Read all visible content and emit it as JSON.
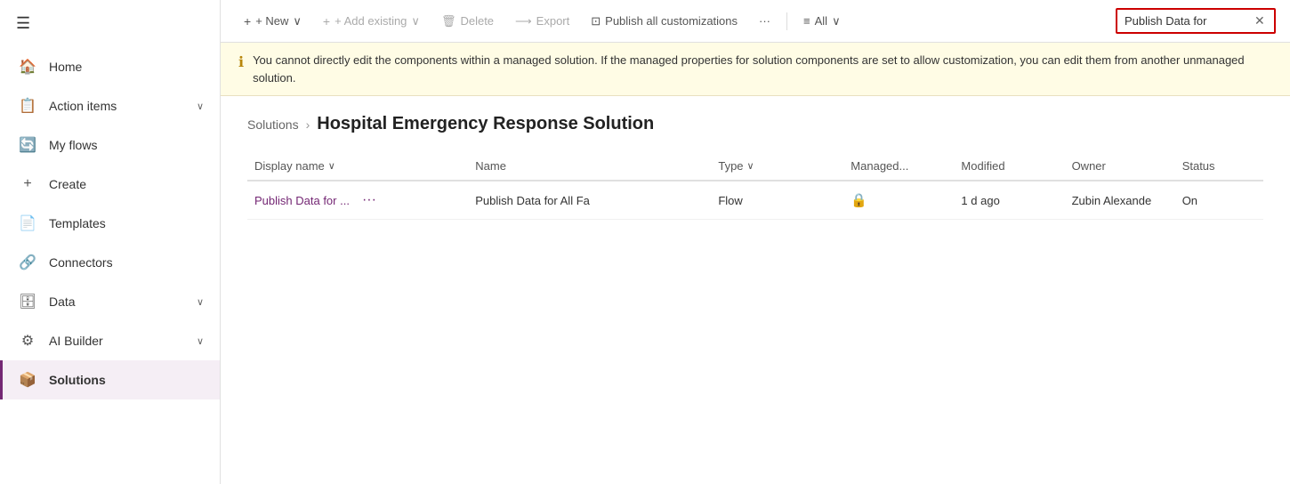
{
  "sidebar": {
    "hamburger_icon": "☰",
    "items": [
      {
        "id": "home",
        "label": "Home",
        "icon": "🏠",
        "active": false,
        "chevron": false
      },
      {
        "id": "action-items",
        "label": "Action items",
        "icon": "📋",
        "active": false,
        "chevron": true
      },
      {
        "id": "my-flows",
        "label": "My flows",
        "icon": "🔄",
        "active": false,
        "chevron": false
      },
      {
        "id": "create",
        "label": "Create",
        "icon": "+",
        "active": false,
        "chevron": false
      },
      {
        "id": "templates",
        "label": "Templates",
        "icon": "📄",
        "active": false,
        "chevron": false
      },
      {
        "id": "connectors",
        "label": "Connectors",
        "icon": "🔗",
        "active": false,
        "chevron": false
      },
      {
        "id": "data",
        "label": "Data",
        "icon": "🗄",
        "active": false,
        "chevron": true
      },
      {
        "id": "ai-builder",
        "label": "AI Builder",
        "icon": "⚙",
        "active": false,
        "chevron": true
      },
      {
        "id": "solutions",
        "label": "Solutions",
        "icon": "📦",
        "active": true,
        "chevron": false
      }
    ]
  },
  "toolbar": {
    "new_label": "+ New",
    "new_chevron": "∨",
    "add_existing_label": "+ Add existing",
    "add_existing_chevron": "∨",
    "delete_label": "Delete",
    "export_label": "Export",
    "publish_label": "Publish all customizations",
    "more_label": "···",
    "filter_label": "All",
    "filter_chevron": "∨",
    "search_value": "Publish Data for",
    "search_placeholder": "Search"
  },
  "warning": {
    "icon": "ℹ",
    "text": "You cannot directly edit the components within a managed solution. If the managed properties for solution components are set to allow customization, you can edit them from another unmanaged solution."
  },
  "breadcrumb": {
    "parent": "Solutions",
    "separator": "›",
    "current": "Hospital Emergency Response Solution"
  },
  "table": {
    "columns": [
      {
        "id": "display-name",
        "label": "Display name",
        "sortable": true
      },
      {
        "id": "name",
        "label": "Name",
        "sortable": false
      },
      {
        "id": "type",
        "label": "Type",
        "sortable": true
      },
      {
        "id": "managed",
        "label": "Managed...",
        "sortable": false
      },
      {
        "id": "modified",
        "label": "Modified",
        "sortable": false
      },
      {
        "id": "owner",
        "label": "Owner",
        "sortable": false
      },
      {
        "id": "status",
        "label": "Status",
        "sortable": false
      }
    ],
    "rows": [
      {
        "display_name": "Publish Data for ...",
        "name": "Publish Data for All Fa",
        "type": "Flow",
        "managed": "🔒",
        "modified": "1 d ago",
        "owner": "Zubin Alexande",
        "status": "On"
      }
    ]
  }
}
